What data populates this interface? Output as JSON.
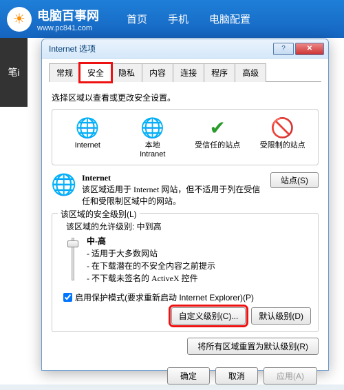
{
  "site": {
    "name": "电脑百事网",
    "url": "www.pc841.com",
    "nav": [
      "首页",
      "手机",
      "电脑配置"
    ]
  },
  "sidebar_label": "笔i",
  "dialog": {
    "title": "Internet 选项",
    "help": "?",
    "close": "✕",
    "tabs": [
      "常规",
      "安全",
      "隐私",
      "内容",
      "连接",
      "程序",
      "高级"
    ],
    "active_tab": 1
  },
  "security": {
    "instruction": "选择区域以查看或更改安全设置。",
    "zones": [
      {
        "label": "Internet",
        "icon": "globe"
      },
      {
        "label": "本地\nIntranet",
        "icon": "globe"
      },
      {
        "label": "受信任的站点",
        "icon": "check"
      },
      {
        "label": "受限制的站点",
        "icon": "forbid"
      }
    ],
    "detail": {
      "title": "Internet",
      "desc": "该区域适用于 Internet 网站，但不适用于列在受信任和受限制区域中的网站。",
      "sites_button": "站点(S)"
    },
    "level_group_title": "该区域的安全级别(L)",
    "allowed_label": "该区域的允许级别: 中到高",
    "level_name": "中-高",
    "level_bullets": [
      "- 适用于大多数网站",
      "- 在下载潜在的不安全内容之前提示",
      "- 不下载未签名的 ActiveX 控件"
    ],
    "protect_mode": "启用保护模式(要求重新启动 Internet Explorer)(P)",
    "custom_button": "自定义级别(C)...",
    "default_button": "默认级别(D)",
    "reset_button": "将所有区域重置为默认级别(R)"
  },
  "footer": {
    "ok": "确定",
    "cancel": "取消",
    "apply": "应用(A)"
  }
}
